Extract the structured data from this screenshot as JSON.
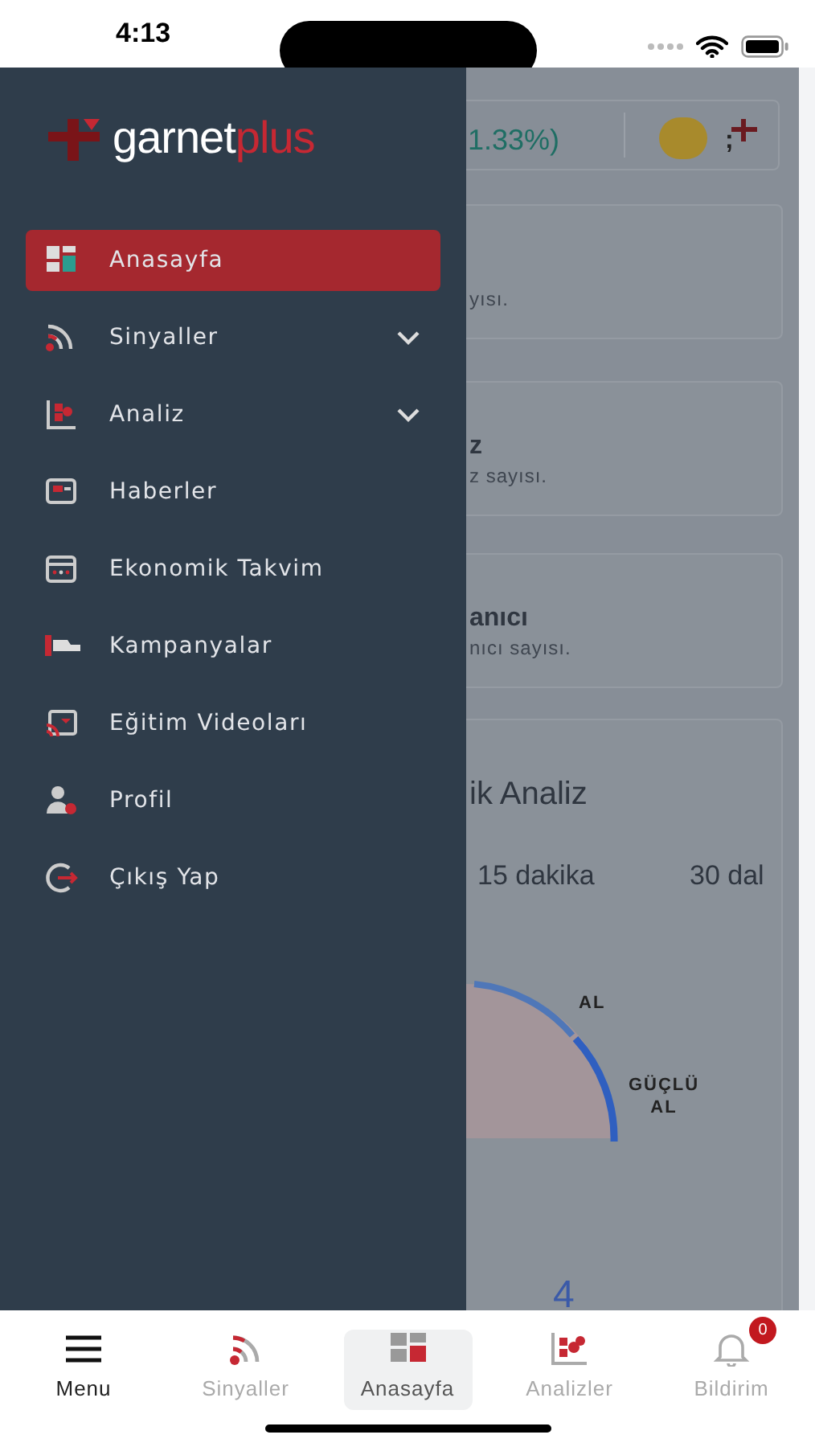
{
  "status_bar": {
    "time": "4:13"
  },
  "background_page": {
    "ticker_change": "1.33%)",
    "ticker_separator": ";",
    "cards": [
      {
        "subtitle": "yısı."
      },
      {
        "title": "z",
        "subtitle": "z sayısı."
      },
      {
        "title": "anıcı",
        "subtitle": "nıcı sayısı."
      }
    ],
    "analysis_title": "ik Analiz",
    "periods": [
      "15 dakika",
      "30 dal"
    ],
    "gauge_labels": [
      {
        "text": "AL"
      },
      {
        "text": "GÜÇLÜ AL"
      }
    ],
    "gauge_value": "4"
  },
  "drawer": {
    "logo": {
      "part_1": "garnet",
      "part_2": "plus"
    },
    "items": [
      {
        "label": "Anasayfa",
        "selected": true,
        "expandable": false
      },
      {
        "label": "Sinyaller",
        "selected": false,
        "expandable": true
      },
      {
        "label": "Analiz",
        "selected": false,
        "expandable": true
      },
      {
        "label": "Haberler",
        "selected": false,
        "expandable": false
      },
      {
        "label": "Ekonomik Takvim",
        "selected": false,
        "expandable": false
      },
      {
        "label": "Kampanyalar",
        "selected": false,
        "expandable": false
      },
      {
        "label": "Eğitim Videoları",
        "selected": false,
        "expandable": false
      },
      {
        "label": "Profil",
        "selected": false,
        "expandable": false
      },
      {
        "label": "Çıkış Yap",
        "selected": false,
        "expandable": false
      }
    ]
  },
  "tab_bar": [
    {
      "label": "Menu",
      "selected": false
    },
    {
      "label": "Sinyaller",
      "selected": false
    },
    {
      "label": "Anasayfa",
      "selected": true
    },
    {
      "label": "Analizler",
      "selected": false
    },
    {
      "label": "Bildirim",
      "selected": false,
      "badge": "0"
    }
  ]
}
